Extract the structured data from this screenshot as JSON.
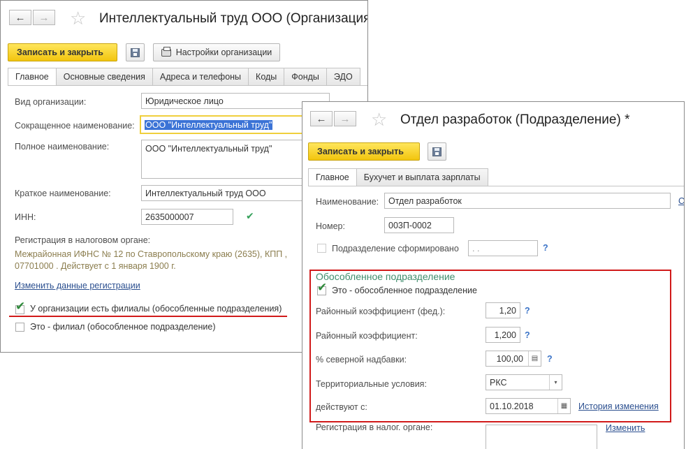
{
  "org_window": {
    "title": "Интеллектуальный труд ООО (Организация)",
    "save_close": "Записать и закрыть",
    "settings_btn": "Настройки организации",
    "tabs": [
      "Главное",
      "Основные сведения",
      "Адреса и телефоны",
      "Коды",
      "Фонды",
      "ЭДО"
    ],
    "fields": {
      "org_type_label": "Вид организации:",
      "org_type_value": "Юридическое лицо",
      "short_name_label": "Сокращенное наименование:",
      "short_name_value": "ООО \"Интеллектуальный труд\"",
      "full_name_label": "Полное наименование:",
      "full_name_value": "ООО \"Интеллектуальный труд\"",
      "brief_name_label": "Краткое наименование:",
      "brief_name_value": "Интеллектуальный труд ООО",
      "inn_label": "ИНН:",
      "inn_value": "2635000007",
      "tax_reg_label": "Регистрация в налоговом органе:",
      "tax_reg_line1": "Межрайонная ИФНС № 12 по Ставропольскому краю  (2635), КПП ,",
      "tax_reg_line2": "07701000    . Действует с 1 января 1900 г.",
      "change_reg_link": "Изменить данные регистрации",
      "has_branches_label": "У организации есть филиалы (обособленные подразделения)",
      "is_branch_label": "Это - филиал (обособленное подразделение)"
    },
    "has_branches_checked": true,
    "is_branch_checked": false
  },
  "dept_window": {
    "title": "Отдел разработок (Подразделение) *",
    "save_close": "Записать и закрыть",
    "tabs": [
      "Главное",
      "Бухучет и выплата зарплаты"
    ],
    "fields": {
      "name_label": "Наименование:",
      "name_value": "Отдел разработок",
      "name_side_link": "С",
      "number_label": "Номер:",
      "number_value": "003П-0002",
      "formed_label": "Подразделение сформировано",
      "formed_date_value": " .  .",
      "question": "?"
    },
    "separate": {
      "section_title": "Обособленное подразделение",
      "is_separate_label": "Это - обособленное подразделение",
      "is_separate_checked": true,
      "district_fed_label": "Районный коэффициент (фед.):",
      "district_fed_value": "1,20",
      "district_label": "Районный коэффициент:",
      "district_value": "1,200",
      "north_label": "% северной надбавки:",
      "north_value": "100,00",
      "territorial_label": "Территориальные условия:",
      "territorial_value": "РКС",
      "valid_from_label": "действуют с:",
      "valid_from_value": "01.10.2018",
      "history_link": "История изменения"
    },
    "tax_reg_label": "Регистрация в налог. органе:",
    "change_link": "Изменить"
  },
  "icons": {
    "back": "←",
    "forward": "→",
    "star": "☆",
    "check": "✔",
    "calendar": "▦",
    "calc": "▤",
    "dropdown": "▾"
  },
  "colors": {
    "accent_yellow": "#f2c50e",
    "highlight_red": "#d11a1a",
    "section_green": "#3f8d6c",
    "link_blue": "#2b4f8f"
  }
}
